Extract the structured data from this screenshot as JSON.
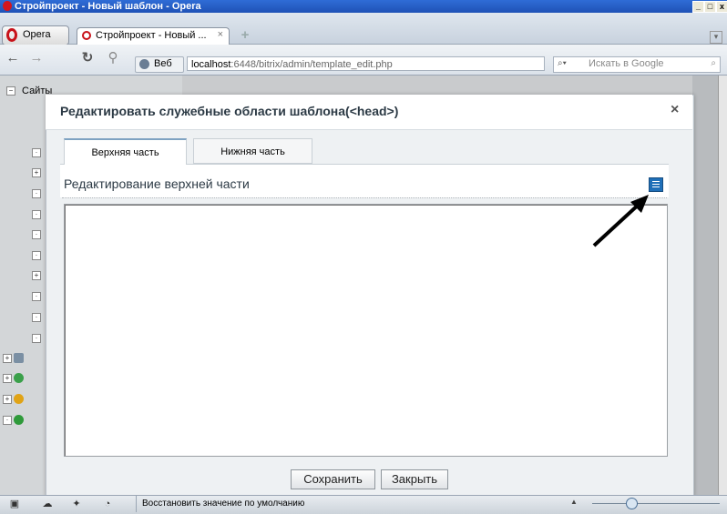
{
  "window": {
    "title": "Стройпроект - Новый шаблон - Opera",
    "controls": [
      "_",
      "□",
      "x"
    ]
  },
  "browser": {
    "menu_label": "Opera",
    "tab_title": "Стройпроект - Новый ...",
    "tab_close": "×",
    "newtab": "+",
    "web_label": "Веб",
    "url_host": "localhost",
    "url_path": ":6448/bitrix/admin/template_edit.php",
    "search_placeholder": "Искать в Google"
  },
  "tree": {
    "root_label": "Сайты"
  },
  "dialog": {
    "title": "Редактировать служебные области шаблона(<head>)",
    "close": "×",
    "tabs": [
      "Верхняя часть",
      "Нижняя часть"
    ],
    "section_title": "Редактирование верхней части",
    "editor_content": "",
    "buttons": {
      "save": "Сохранить",
      "close": "Закрыть"
    }
  },
  "statusbar": {
    "text": "Восстановить значение по умолчанию"
  },
  "colors": {
    "titlebar": "#2f6cd6",
    "accent": "#1f6fb8",
    "opera_red": "#c8121a"
  }
}
